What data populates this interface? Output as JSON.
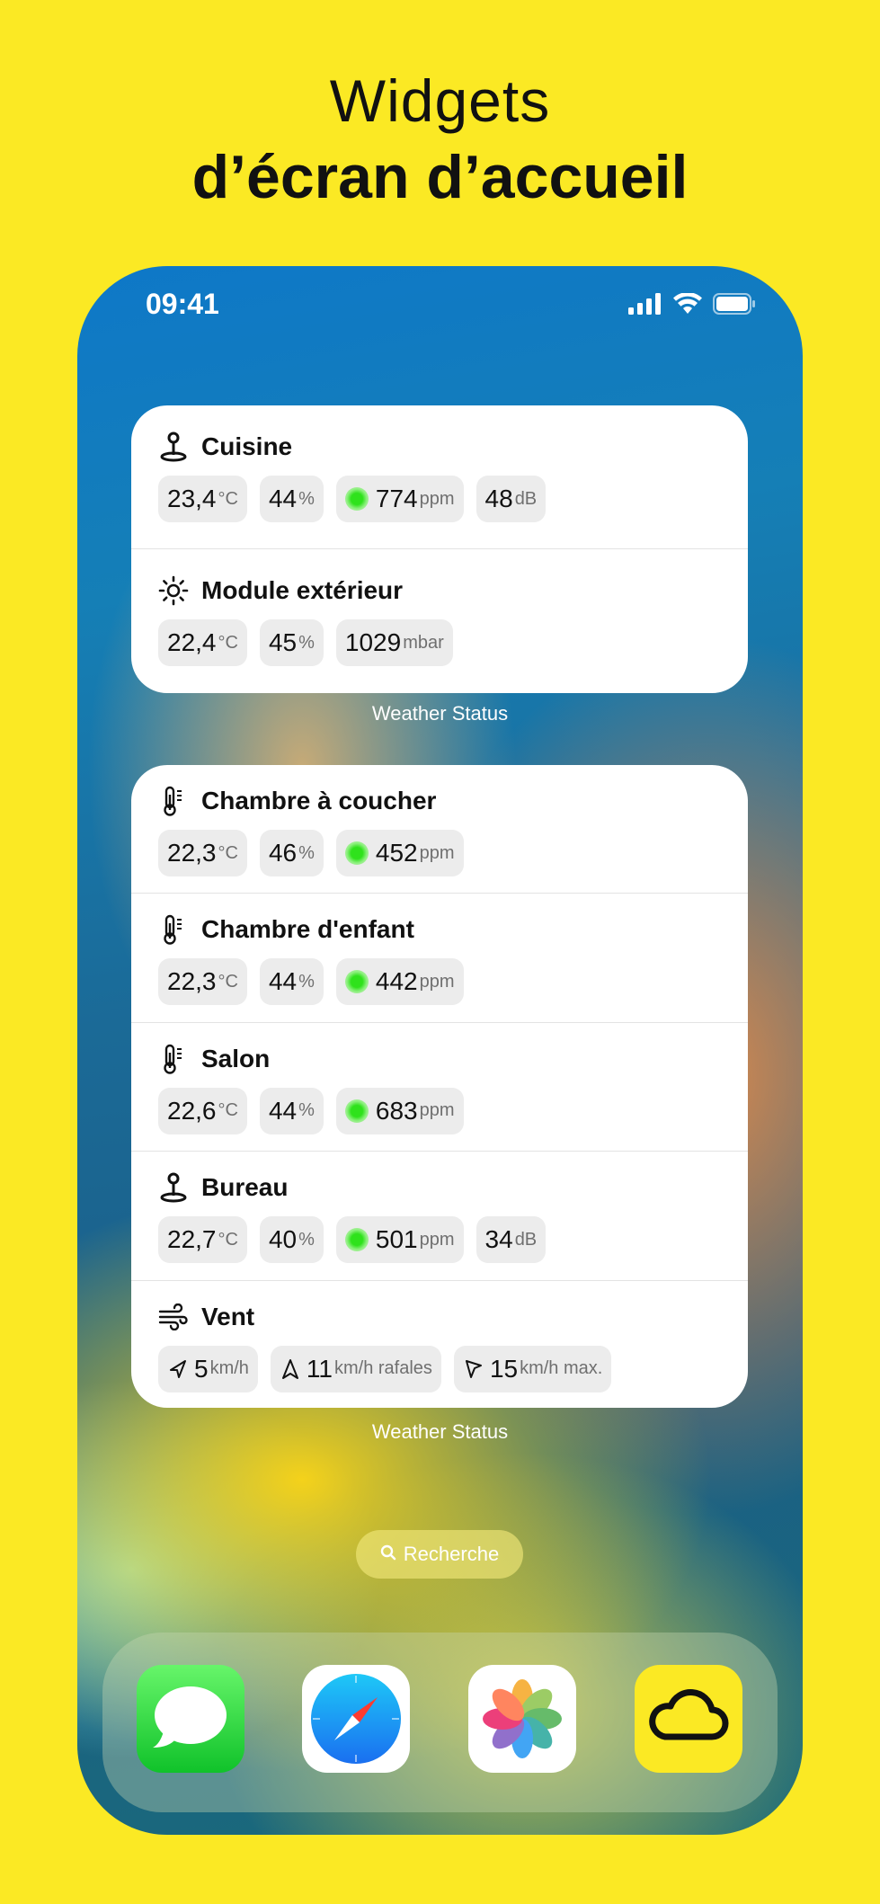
{
  "headline": {
    "line1": "Widgets",
    "line2": "d’écran d’accueil"
  },
  "status_bar": {
    "time": "09:41"
  },
  "widget1": {
    "rows": [
      {
        "title": "Cuisine",
        "icon": "location-pin-icon",
        "values": [
          {
            "value": "23,4",
            "unit": "°C"
          },
          {
            "value": "44",
            "unit": "%"
          },
          {
            "value": "774",
            "unit": "ppm",
            "dot": true
          },
          {
            "value": "48",
            "unit": "dB"
          }
        ]
      },
      {
        "title": "Module extérieur",
        "icon": "sun-icon",
        "values": [
          {
            "value": "22,4",
            "unit": "°C"
          },
          {
            "value": "45",
            "unit": "%"
          },
          {
            "value": "1029",
            "unit": "mbar"
          }
        ]
      }
    ],
    "caption": "Weather Status"
  },
  "widget2": {
    "rows": [
      {
        "title": "Chambre à coucher",
        "icon": "thermometer-icon",
        "values": [
          {
            "value": "22,3",
            "unit": "°C"
          },
          {
            "value": "46",
            "unit": "%"
          },
          {
            "value": "452",
            "unit": "ppm",
            "dot": true
          }
        ]
      },
      {
        "title": "Chambre d'enfant",
        "icon": "thermometer-icon",
        "values": [
          {
            "value": "22,3",
            "unit": "°C"
          },
          {
            "value": "44",
            "unit": "%"
          },
          {
            "value": "442",
            "unit": "ppm",
            "dot": true
          }
        ]
      },
      {
        "title": "Salon",
        "icon": "thermometer-icon",
        "values": [
          {
            "value": "22,6",
            "unit": "°C"
          },
          {
            "value": "44",
            "unit": "%"
          },
          {
            "value": "683",
            "unit": "ppm",
            "dot": true
          }
        ]
      },
      {
        "title": "Bureau",
        "icon": "location-pin-icon",
        "values": [
          {
            "value": "22,7",
            "unit": "°C"
          },
          {
            "value": "40",
            "unit": "%"
          },
          {
            "value": "501",
            "unit": "ppm",
            "dot": true
          },
          {
            "value": "34",
            "unit": "dB"
          }
        ]
      },
      {
        "title": "Vent",
        "icon": "wind-icon",
        "values": [
          {
            "value": "5",
            "unit": "km/h"
          },
          {
            "value": "11",
            "unit": "km/h rafales"
          },
          {
            "value": "15",
            "unit": "km/h max."
          }
        ]
      }
    ],
    "caption": "Weather Status"
  },
  "search": {
    "label": "Recherche"
  },
  "dock": {
    "apps": [
      "messages-app-icon",
      "safari-app-icon",
      "photos-app-icon",
      "weather-status-app-icon"
    ]
  },
  "colors": {
    "background": "#fbe924",
    "co2_dot": "#2fe21c"
  }
}
